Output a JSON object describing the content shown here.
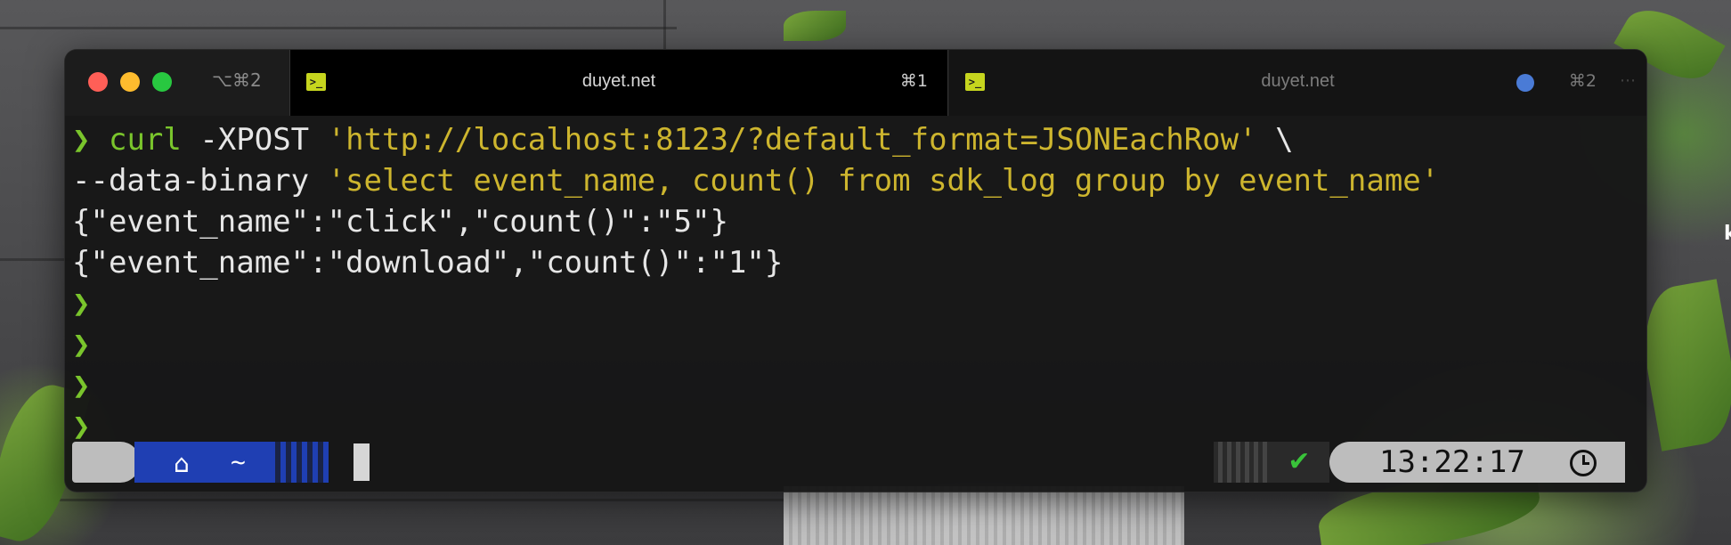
{
  "window": {
    "shortcut": "⌥⌘2",
    "tabs": [
      {
        "title": "duyet.net",
        "shortcut": "⌘1",
        "active": true,
        "icon": "terminal-icon"
      },
      {
        "title": "duyet.net",
        "shortcut": "⌘2",
        "active": false,
        "icon": "terminal-icon",
        "indicator_color": "#4a7bd6"
      }
    ]
  },
  "terminal": {
    "prompt_symbol": "❯",
    "command": "curl",
    "flag": " -XPOST ",
    "url": "'http://localhost:8123/?default_format=JSONEachRow'",
    "continuation": " \\",
    "data_flag": "--data-binary ",
    "query": "'select event_name, count() from sdk_log group by event_name'",
    "output": [
      "{\"event_name\":\"click\",\"count()\":\"5\"}",
      "{\"event_name\":\"download\",\"count()\":\"1\"}"
    ],
    "empty_prompts": 4
  },
  "statusbar": {
    "os_icon": "apple-icon",
    "home_icon": "home-icon",
    "directory": "~",
    "status_symbol": "✔",
    "time": "13:22:17",
    "time_icon": "clock-icon"
  },
  "colors": {
    "prompt": "#7ac52c",
    "string": "#cdb52e",
    "dir_segment": "#1f3fb3",
    "segment_gray": "#bdbdbd"
  },
  "background": {
    "peek_text": "k"
  }
}
